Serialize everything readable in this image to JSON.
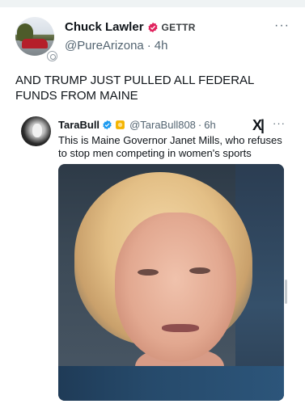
{
  "post": {
    "author": {
      "display_name": "Chuck Lawler",
      "network_tag": "GETTR",
      "handle": "@PureArizona",
      "separator": "·",
      "time": "4h",
      "verified_color": "#e0245e"
    },
    "more_label": "···",
    "text": "AND TRUMP JUST PULLED ALL FEDERAL FUNDS FROM MAINE"
  },
  "quote": {
    "author": {
      "display_name": "TaraBull",
      "handle": "@TaraBull808",
      "separator": "·",
      "time": "6h",
      "verified_color": "#1d9bf0",
      "badge_color": "#f4b400"
    },
    "logo_text": "X|",
    "more_label": "···",
    "text": "This is Maine Governor Janet Mills, who refuses to stop men competing in women's sports",
    "image": {
      "icon": "portrait-photo"
    }
  },
  "colors": {
    "text_primary": "#0f1419",
    "text_secondary": "#536471",
    "top_divider": "#eff3f4"
  }
}
